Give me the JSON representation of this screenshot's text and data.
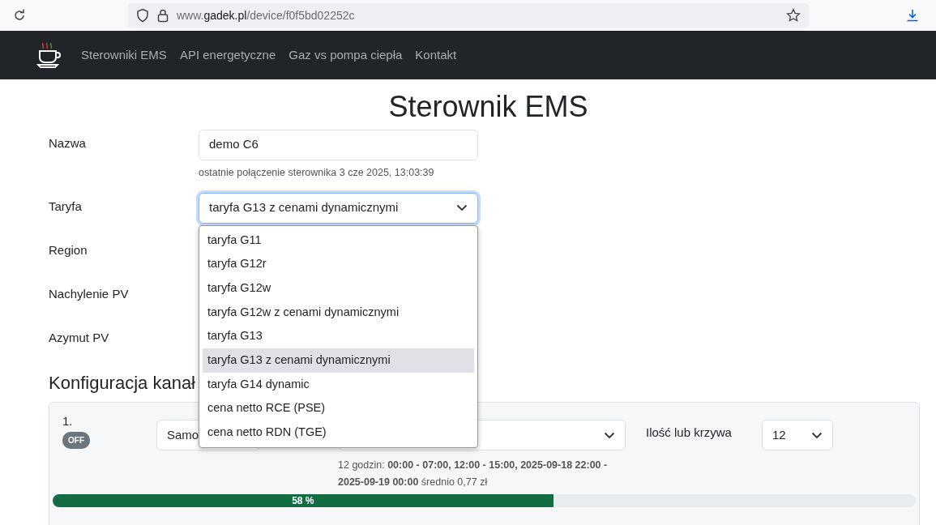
{
  "browser": {
    "url_prefix": "www.",
    "url_domain": "gadek.pl",
    "url_path": "/device/f0f5bd02252c"
  },
  "navbar": {
    "links": [
      "Sterowniki EMS",
      "API energetyczne",
      "Gaz vs pompa ciepła",
      "Kontakt"
    ]
  },
  "title": "Sterownik EMS",
  "form": {
    "name": {
      "label": "Nazwa",
      "value": "demo C6",
      "hint": "ostatnie połączenie sterownika 3 cze 2025, 13:03:39"
    },
    "tariff": {
      "label": "Taryfa",
      "value": "taryfa G13 z cenami dynamicznymi",
      "expanded": true,
      "options": [
        {
          "label": "taryfa G11",
          "selected": false
        },
        {
          "label": "taryfa G12r",
          "selected": false
        },
        {
          "label": "taryfa G12w",
          "selected": false
        },
        {
          "label": "taryfa G12w z cenami dynamicznymi",
          "selected": false
        },
        {
          "label": "taryfa G13",
          "selected": false
        },
        {
          "label": "taryfa G13 z cenami dynamicznymi",
          "selected": true
        },
        {
          "label": "taryfa G14 dynamic",
          "selected": false
        },
        {
          "label": "cena netto RCE (PSE)",
          "selected": false
        },
        {
          "label": "cena netto RDN (TGE)",
          "selected": false
        }
      ]
    },
    "other_fields": [
      {
        "label": "Region"
      },
      {
        "label": "Nachylenie PV"
      },
      {
        "label": "Azymut PV"
      }
    ]
  },
  "channels_heading": "Konfiguracja kanał",
  "channels": [
    {
      "number": "1.",
      "on": false,
      "badge": "OFF",
      "mode": "Samo",
      "amount_label": "Ilość lub krzywa",
      "amount": "12",
      "summary": "12 godzin: **00:00 - 07:00, 12:00 - 15:00, 2025-09-18 22:00 - 2025-09-19 00:00** średnio 0,77 zł",
      "level": 0.58,
      "progress_label": "58 %"
    }
  ]
}
